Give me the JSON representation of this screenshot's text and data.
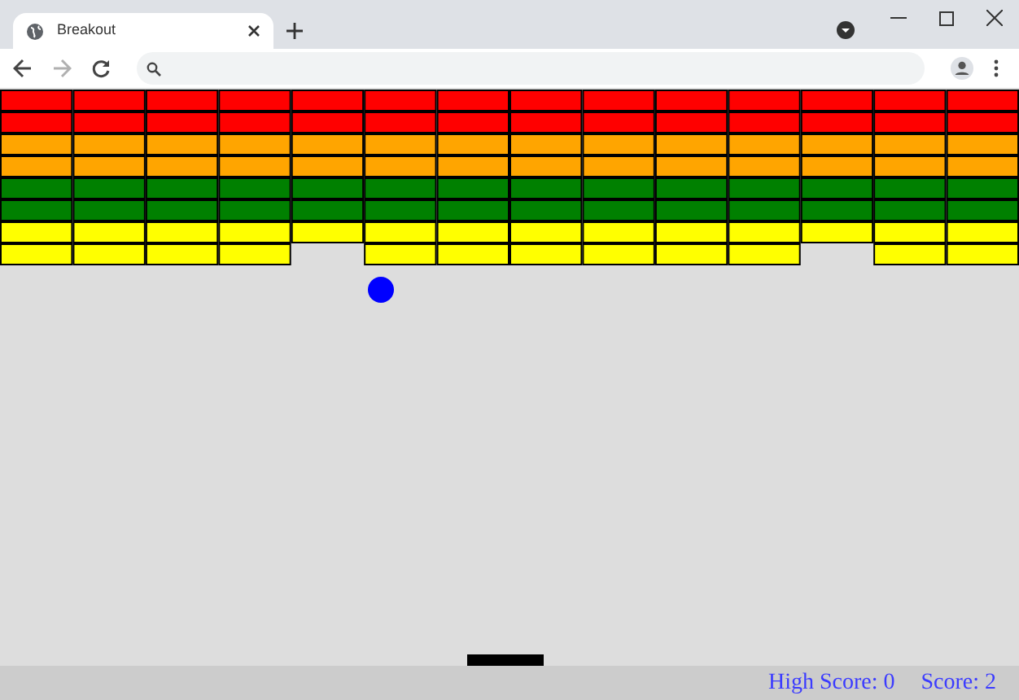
{
  "browser": {
    "tabs": [
      {
        "title": "Breakout",
        "selected": true
      }
    ],
    "forward_disabled": true
  },
  "game": {
    "brick_rows": [
      {
        "color": "#ff0000",
        "bricks": [
          {
            "broken": false
          },
          {
            "broken": false
          },
          {
            "broken": false
          },
          {
            "broken": false
          },
          {
            "broken": false
          },
          {
            "broken": false
          },
          {
            "broken": false
          },
          {
            "broken": false
          },
          {
            "broken": false
          },
          {
            "broken": false
          },
          {
            "broken": false
          },
          {
            "broken": false
          },
          {
            "broken": false
          },
          {
            "broken": false
          }
        ]
      },
      {
        "color": "#ff0000",
        "bricks": [
          {
            "broken": false
          },
          {
            "broken": false
          },
          {
            "broken": false
          },
          {
            "broken": false
          },
          {
            "broken": false
          },
          {
            "broken": false
          },
          {
            "broken": false
          },
          {
            "broken": false
          },
          {
            "broken": false
          },
          {
            "broken": false
          },
          {
            "broken": false
          },
          {
            "broken": false
          },
          {
            "broken": false
          },
          {
            "broken": false
          }
        ]
      },
      {
        "color": "#ffa500",
        "bricks": [
          {
            "broken": false
          },
          {
            "broken": false
          },
          {
            "broken": false
          },
          {
            "broken": false
          },
          {
            "broken": false
          },
          {
            "broken": false
          },
          {
            "broken": false
          },
          {
            "broken": false
          },
          {
            "broken": false
          },
          {
            "broken": false
          },
          {
            "broken": false
          },
          {
            "broken": false
          },
          {
            "broken": false
          },
          {
            "broken": false
          }
        ]
      },
      {
        "color": "#ffa500",
        "bricks": [
          {
            "broken": false
          },
          {
            "broken": false
          },
          {
            "broken": false
          },
          {
            "broken": false
          },
          {
            "broken": false
          },
          {
            "broken": false
          },
          {
            "broken": false
          },
          {
            "broken": false
          },
          {
            "broken": false
          },
          {
            "broken": false
          },
          {
            "broken": false
          },
          {
            "broken": false
          },
          {
            "broken": false
          },
          {
            "broken": false
          }
        ]
      },
      {
        "color": "#008000",
        "bricks": [
          {
            "broken": false
          },
          {
            "broken": false
          },
          {
            "broken": false
          },
          {
            "broken": false
          },
          {
            "broken": false
          },
          {
            "broken": false
          },
          {
            "broken": false
          },
          {
            "broken": false
          },
          {
            "broken": false
          },
          {
            "broken": false
          },
          {
            "broken": false
          },
          {
            "broken": false
          },
          {
            "broken": false
          },
          {
            "broken": false
          }
        ]
      },
      {
        "color": "#008000",
        "bricks": [
          {
            "broken": false
          },
          {
            "broken": false
          },
          {
            "broken": false
          },
          {
            "broken": false
          },
          {
            "broken": false
          },
          {
            "broken": false
          },
          {
            "broken": false
          },
          {
            "broken": false
          },
          {
            "broken": false
          },
          {
            "broken": false
          },
          {
            "broken": false
          },
          {
            "broken": false
          },
          {
            "broken": false
          },
          {
            "broken": false
          }
        ]
      },
      {
        "color": "#ffff00",
        "bricks": [
          {
            "broken": false
          },
          {
            "broken": false
          },
          {
            "broken": false
          },
          {
            "broken": false
          },
          {
            "broken": false
          },
          {
            "broken": false
          },
          {
            "broken": false
          },
          {
            "broken": false
          },
          {
            "broken": false
          },
          {
            "broken": false
          },
          {
            "broken": false
          },
          {
            "broken": false
          },
          {
            "broken": false
          },
          {
            "broken": false
          }
        ]
      },
      {
        "color": "#ffff00",
        "bricks": [
          {
            "broken": false
          },
          {
            "broken": false
          },
          {
            "broken": false
          },
          {
            "broken": false
          },
          {
            "broken": true
          },
          {
            "broken": false
          },
          {
            "broken": false
          },
          {
            "broken": false
          },
          {
            "broken": false
          },
          {
            "broken": false
          },
          {
            "broken": false
          },
          {
            "broken": true
          },
          {
            "broken": false
          },
          {
            "broken": false
          }
        ]
      }
    ],
    "score_bar": {
      "high_score": "High Score: 0",
      "score": "Score: 2"
    }
  }
}
